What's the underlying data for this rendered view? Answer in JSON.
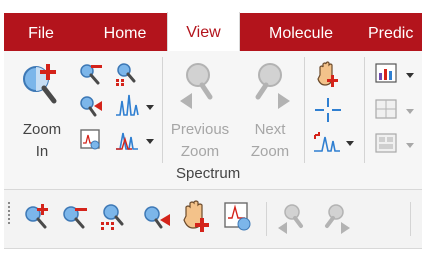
{
  "tabs": [
    {
      "label": "File",
      "active": false
    },
    {
      "label": "Home",
      "active": false
    },
    {
      "label": "View",
      "active": true
    },
    {
      "label": "Molecule",
      "active": false
    },
    {
      "label": "Predic",
      "active": false
    }
  ],
  "ribbon": {
    "zoom_in": {
      "line1": "Zoom",
      "line2": "In"
    },
    "previous_zoom": {
      "line1": "Previous",
      "line2": "Zoom"
    },
    "next_zoom": {
      "line1": "Next",
      "line2": "Zoom"
    },
    "group_label": "Spectrum"
  },
  "colors": {
    "brand": "#b3141c",
    "accent_red": "#d4231a",
    "accent_blue": "#2f7fd1"
  }
}
